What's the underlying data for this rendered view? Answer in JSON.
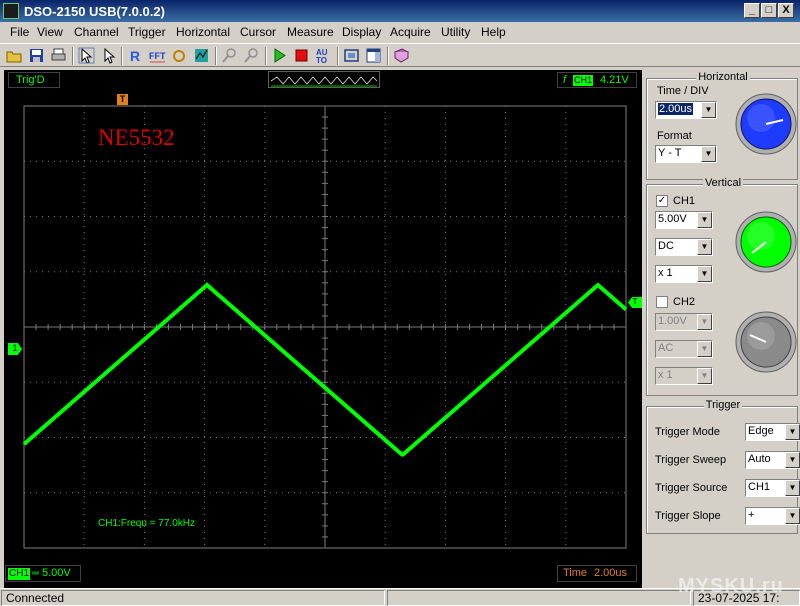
{
  "window": {
    "title": "DSO-2150 USB(7.0.0.2)",
    "minimize": "_",
    "restore": "□",
    "close": "X"
  },
  "menu": [
    "File",
    "View",
    "Channel",
    "Trigger",
    "Horizontal",
    "Cursor",
    "Measure",
    "Display",
    "Acquire",
    "Utility",
    "Help"
  ],
  "toolbar": {
    "icons": [
      "open-icon",
      "save-icon",
      "print-icon",
      "pointer-select-icon",
      "cursor-icon",
      "reference-icon",
      "fft-icon",
      "math-icon",
      "persist-icon",
      "zoom-in-icon",
      "zoom-out-icon",
      "run-icon",
      "stop-icon",
      "auto-icon",
      "screenshot-icon",
      "layout-icon",
      "help-book-icon"
    ]
  },
  "scope": {
    "trig_status": "Trig'D",
    "trigger_edge_symbol": "f",
    "trigger_channel": "CH1",
    "trigger_level": "4.21V",
    "overlay_text": "NE5532",
    "measurement": "CH1:Frequ = 77.0kHz",
    "ch1_scale_channel": "CH1",
    "ch1_scale_value": "5.00V",
    "time_label": "Time",
    "time_value": "2.00us",
    "marker_trigger_pos": "T",
    "marker_ch1": "1",
    "marker_trig_level": "T",
    "colors": {
      "trace": "#00ff00",
      "overlay": "#e00000",
      "grid": "#808080"
    },
    "waveform": {
      "shape": "triangle",
      "frequency_khz": 77.0,
      "vertical_div": "5.00V",
      "time_div": "2.00us"
    }
  },
  "panel": {
    "horizontal": {
      "title": "Horizontal",
      "time_div_label": "Time / DIV",
      "time_div_value": "2.00us",
      "format_label": "Format",
      "format_value": "Y - T"
    },
    "vertical": {
      "title": "Vertical",
      "ch1": {
        "label": "CH1",
        "enabled": true,
        "volts": "5.00V",
        "coupling": "DC",
        "probe": "x 1"
      },
      "ch2": {
        "label": "CH2",
        "enabled": false,
        "volts": "1.00V",
        "coupling": "AC",
        "probe": "x 1"
      }
    },
    "trigger": {
      "title": "Trigger",
      "rows": [
        {
          "label": "Trigger Mode",
          "value": "Edge"
        },
        {
          "label": "Trigger Sweep",
          "value": "Auto"
        },
        {
          "label": "Trigger Source",
          "value": "CH1"
        },
        {
          "label": "Trigger Slope",
          "value": "+"
        }
      ]
    },
    "knob_colors": {
      "horizontal": "#1e3cff",
      "ch1": "#00ff00",
      "ch2": "#8a8a8a"
    }
  },
  "status": {
    "connection": "Connected",
    "datetime": "23-07-2025  17:"
  },
  "watermark": "MYSKU.ru"
}
